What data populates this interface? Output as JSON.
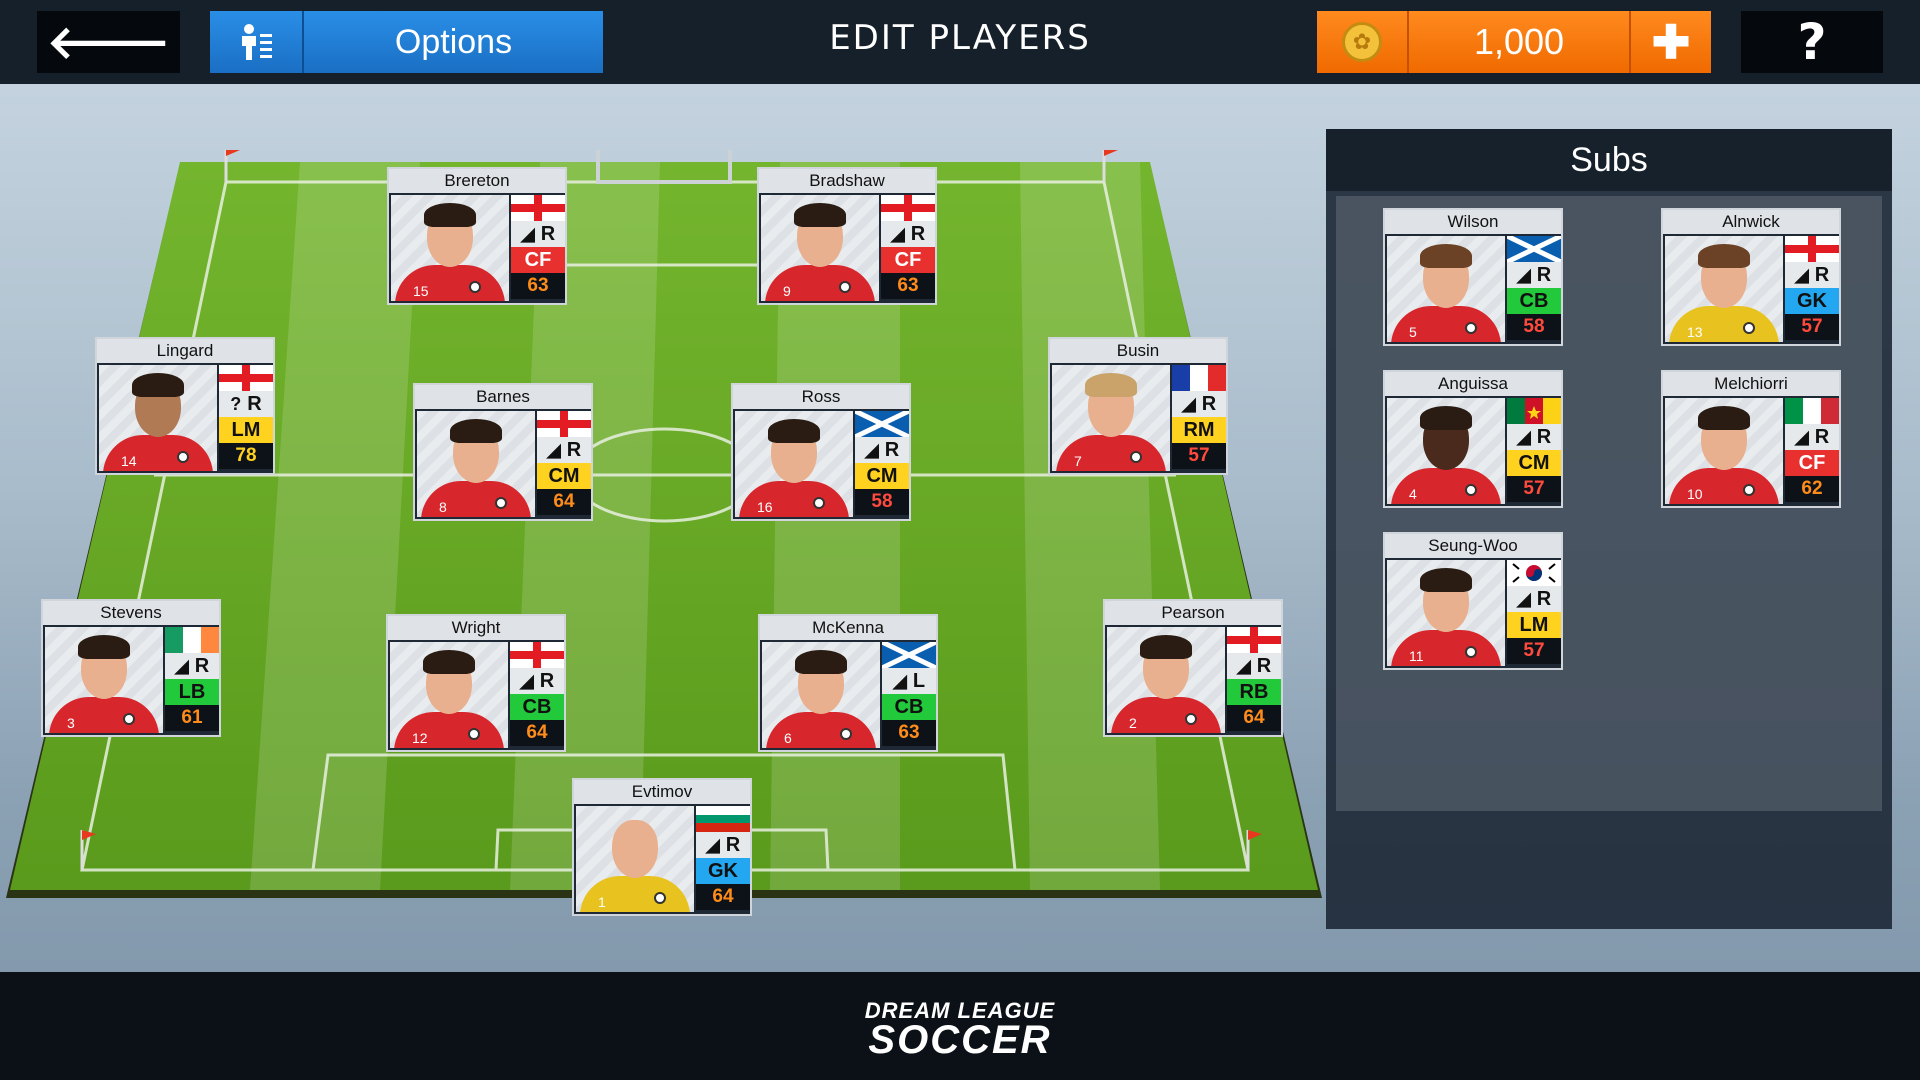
{
  "header": {
    "back_icon": "arrow-left-icon",
    "back_glyph": "🡐",
    "options_label": "Options",
    "options_icon": "formation-edit-icon",
    "title": "EDIT PLAYERS",
    "coins": "1,000",
    "coin_icon": "coin-icon",
    "add_glyph": "✚",
    "help_glyph": "?"
  },
  "subs_title": "Subs",
  "footer": {
    "logo_line1": "DREAM LEAGUE",
    "logo_line2": "SOCCER"
  },
  "colors": {
    "CF": "#e8302f",
    "LM": "#ffd21f",
    "RM": "#ffd21f",
    "CM": "#ffd21f",
    "LB": "#22c93a",
    "RB": "#22c93a",
    "CB": "#22c93a",
    "GK": "#22a7f0",
    "rating_red": "#ff4a3d",
    "rating_orange": "#ff8c1a",
    "rating_yellow": "#ffd21f"
  },
  "lineup": [
    {
      "name": "Brereton",
      "flag": "england",
      "foot": "R",
      "pos": "CF",
      "rating": "63",
      "number": "15",
      "kit": "red",
      "skin": "light",
      "hair": "dark"
    },
    {
      "name": "Bradshaw",
      "flag": "england",
      "foot": "R",
      "pos": "CF",
      "rating": "63",
      "number": "9",
      "kit": "red",
      "skin": "light",
      "hair": "dark"
    },
    {
      "name": "Lingard",
      "flag": "england",
      "foot": "R",
      "foot_unknown": true,
      "pos": "LM",
      "rating": "78",
      "number": "14",
      "kit": "red",
      "skin": "tan",
      "hair": "dark"
    },
    {
      "name": "Barnes",
      "flag": "england",
      "foot": "R",
      "pos": "CM",
      "rating": "64",
      "number": "8",
      "kit": "red",
      "skin": "light",
      "hair": "dark"
    },
    {
      "name": "Ross",
      "flag": "scotland",
      "foot": "R",
      "pos": "CM",
      "rating": "58",
      "number": "16",
      "kit": "red",
      "skin": "light",
      "hair": "dark"
    },
    {
      "name": "Busin",
      "flag": "france",
      "foot": "R",
      "pos": "RM",
      "rating": "57",
      "number": "7",
      "kit": "red",
      "skin": "light",
      "hair": "blond"
    },
    {
      "name": "Stevens",
      "flag": "ireland",
      "foot": "R",
      "pos": "LB",
      "rating": "61",
      "number": "3",
      "kit": "red",
      "skin": "light",
      "hair": "dark"
    },
    {
      "name": "Wright",
      "flag": "england",
      "foot": "R",
      "pos": "CB",
      "rating": "64",
      "number": "12",
      "kit": "red",
      "skin": "light",
      "hair": "dark"
    },
    {
      "name": "McKenna",
      "flag": "scotland",
      "foot": "L",
      "pos": "CB",
      "rating": "63",
      "number": "6",
      "kit": "red",
      "skin": "light",
      "hair": "dark"
    },
    {
      "name": "Pearson",
      "flag": "england",
      "foot": "R",
      "pos": "RB",
      "rating": "64",
      "number": "2",
      "kit": "red",
      "skin": "light",
      "hair": "dark"
    },
    {
      "name": "Evtimov",
      "flag": "bulgaria",
      "foot": "R",
      "pos": "GK",
      "rating": "64",
      "number": "1",
      "kit": "yellow",
      "skin": "light",
      "hair": "none"
    }
  ],
  "subs": [
    {
      "name": "Wilson",
      "flag": "scotland",
      "foot": "R",
      "pos": "CB",
      "rating": "58",
      "number": "5",
      "kit": "red",
      "skin": "light",
      "hair": "brown"
    },
    {
      "name": "Alnwick",
      "flag": "england",
      "foot": "R",
      "pos": "GK",
      "rating": "57",
      "number": "13",
      "kit": "yellow",
      "skin": "light",
      "hair": "brown"
    },
    {
      "name": "Anguissa",
      "flag": "cameroon",
      "foot": "R",
      "pos": "CM",
      "rating": "57",
      "number": "4",
      "kit": "red",
      "skin": "dark",
      "hair": "dark"
    },
    {
      "name": "Melchiorri",
      "flag": "italy",
      "foot": "R",
      "pos": "CF",
      "rating": "62",
      "number": "10",
      "kit": "red",
      "skin": "light",
      "hair": "dark"
    },
    {
      "name": "Seung-Woo",
      "flag": "south-korea",
      "foot": "R",
      "pos": "LM",
      "rating": "57",
      "number": "11",
      "kit": "red",
      "skin": "light",
      "hair": "dark"
    }
  ]
}
